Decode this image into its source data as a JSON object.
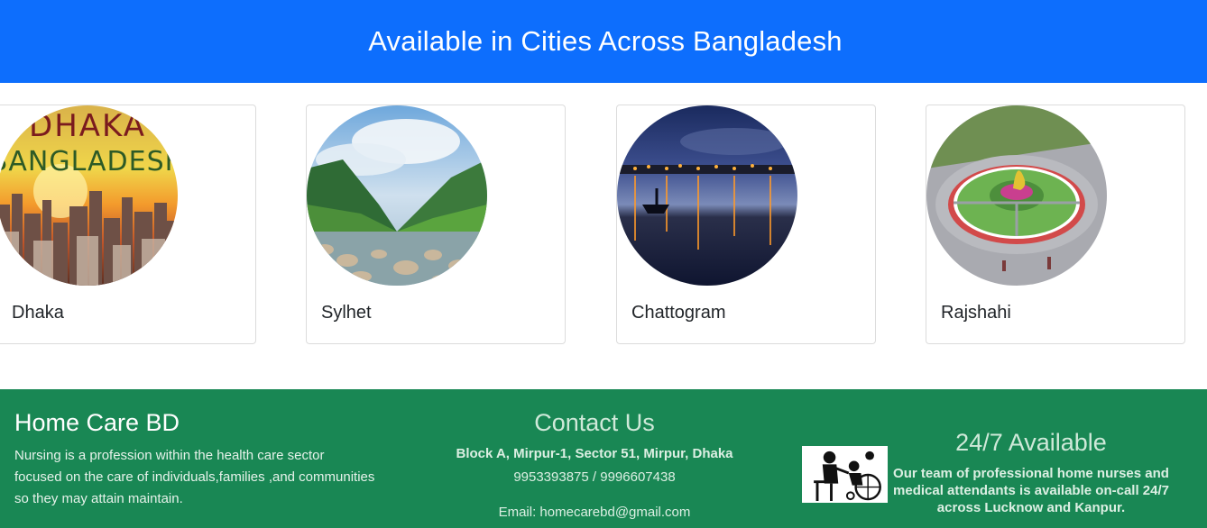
{
  "section": {
    "title": "Available in Cities Across Bangladesh"
  },
  "cities": [
    {
      "name": "Dhaka",
      "photo_text": [
        "DHAKA",
        "BANGLADESH"
      ]
    },
    {
      "name": "Sylhet"
    },
    {
      "name": "Chattogram"
    },
    {
      "name": "Rajshahi"
    }
  ],
  "footer": {
    "brand": {
      "title": "Home Care BD",
      "description": "Nursing is a profession within the health care sector focused on the care of individuals,families ,and communities so they may attain maintain."
    },
    "contact": {
      "title": "Contact Us",
      "address": "Block A, Mirpur-1, Sector 51, Mirpur, Dhaka",
      "phone": "9953393875 / 9996607438",
      "email": "Email: homecarebd@gmail.com"
    },
    "availability": {
      "title": "24/7 Available",
      "description": "Our team of professional home nurses and medical attendants is available on-call 24/7 across Lucknow and Kanpur.",
      "icon": "caregiver-wheelchair-icon"
    }
  },
  "colors": {
    "header_bg": "#0d6efd",
    "footer_bg": "#198754"
  }
}
